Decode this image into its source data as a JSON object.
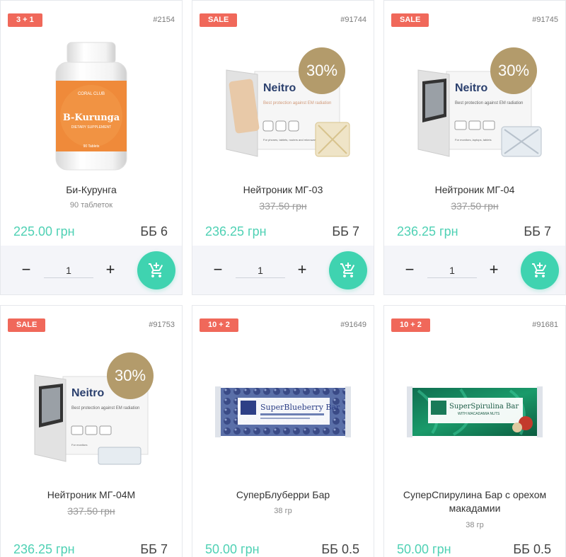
{
  "products": [
    {
      "badge": "3 + 1",
      "sku": "#2154",
      "name": "Би-Курунга",
      "subtitle": "90 таблеток",
      "price": "225.00 грн",
      "bb": "ББ 6",
      "qty": "1",
      "image": "supplement-jar-image",
      "package_text": {
        "brand": "CORAL CLUB",
        "title": "B-Kurunga",
        "tagline": "DIETARY SUPPLEMENT",
        "count": "90 Tablets"
      }
    },
    {
      "badge": "SALE",
      "sku": "#91744",
      "name": "Нейтроник МГ-03",
      "old_price": "337.50 грн",
      "price": "236.25 грн",
      "bb": "ББ 7",
      "qty": "1",
      "discount": "30%",
      "image": "neitronic-box-image",
      "package_text": {
        "brand": "Neitro",
        "desc": "Best protection against EM radiation",
        "small": "For phones, tablets, routers and microwave ovens"
      }
    },
    {
      "badge": "SALE",
      "sku": "#91745",
      "name": "Нейтроник МГ-04",
      "old_price": "337.50 грн",
      "price": "236.25 грн",
      "bb": "ББ 7",
      "qty": "1",
      "discount": "30%",
      "image": "neitronic-box-image",
      "package_text": {
        "brand": "Neitro",
        "desc": "Best protection against EM radiation",
        "small": "For monitors, laptops, tablets"
      }
    },
    {
      "badge": "SALE",
      "sku": "#91753",
      "name": "Нейтроник МГ-04М",
      "old_price": "337.50 грн",
      "price": "236.25 грн",
      "bb": "ББ 7",
      "discount": "30%",
      "image": "neitronic-box-image",
      "package_text": {
        "brand": "Neitro",
        "desc": "Best protection against EM radiation",
        "small": "For monitors"
      }
    },
    {
      "badge": "10 + 2",
      "sku": "#91649",
      "name": "СуперБлуберри Бар",
      "subtitle": "38 гр",
      "price": "50.00 грн",
      "bb": "ББ 0.5",
      "image": "blueberry-bar-image",
      "package_text": {
        "title": "SuperBlueberry Bar"
      }
    },
    {
      "badge": "10 + 2",
      "sku": "#91681",
      "name": "СуперСпирулина Бар с орехом макадамии",
      "subtitle": "38 гр",
      "price": "50.00 грн",
      "bb": "ББ 0.5",
      "image": "spirulina-bar-image",
      "package_text": {
        "title": "SuperSpirulina Bar",
        "sub": "WITH MACADAMIA NUTS"
      }
    }
  ],
  "colors": {
    "badge": "#f0685a",
    "price": "#4fd1b4",
    "cart_button": "#3fd3b0",
    "discount": "#b39b6b",
    "actions_bg": "#f4f5f9"
  },
  "icons": {
    "minus": "minus-icon",
    "plus": "plus-icon",
    "cart": "add-to-cart-icon"
  },
  "symbols": {
    "minus": "−",
    "plus": "+"
  }
}
